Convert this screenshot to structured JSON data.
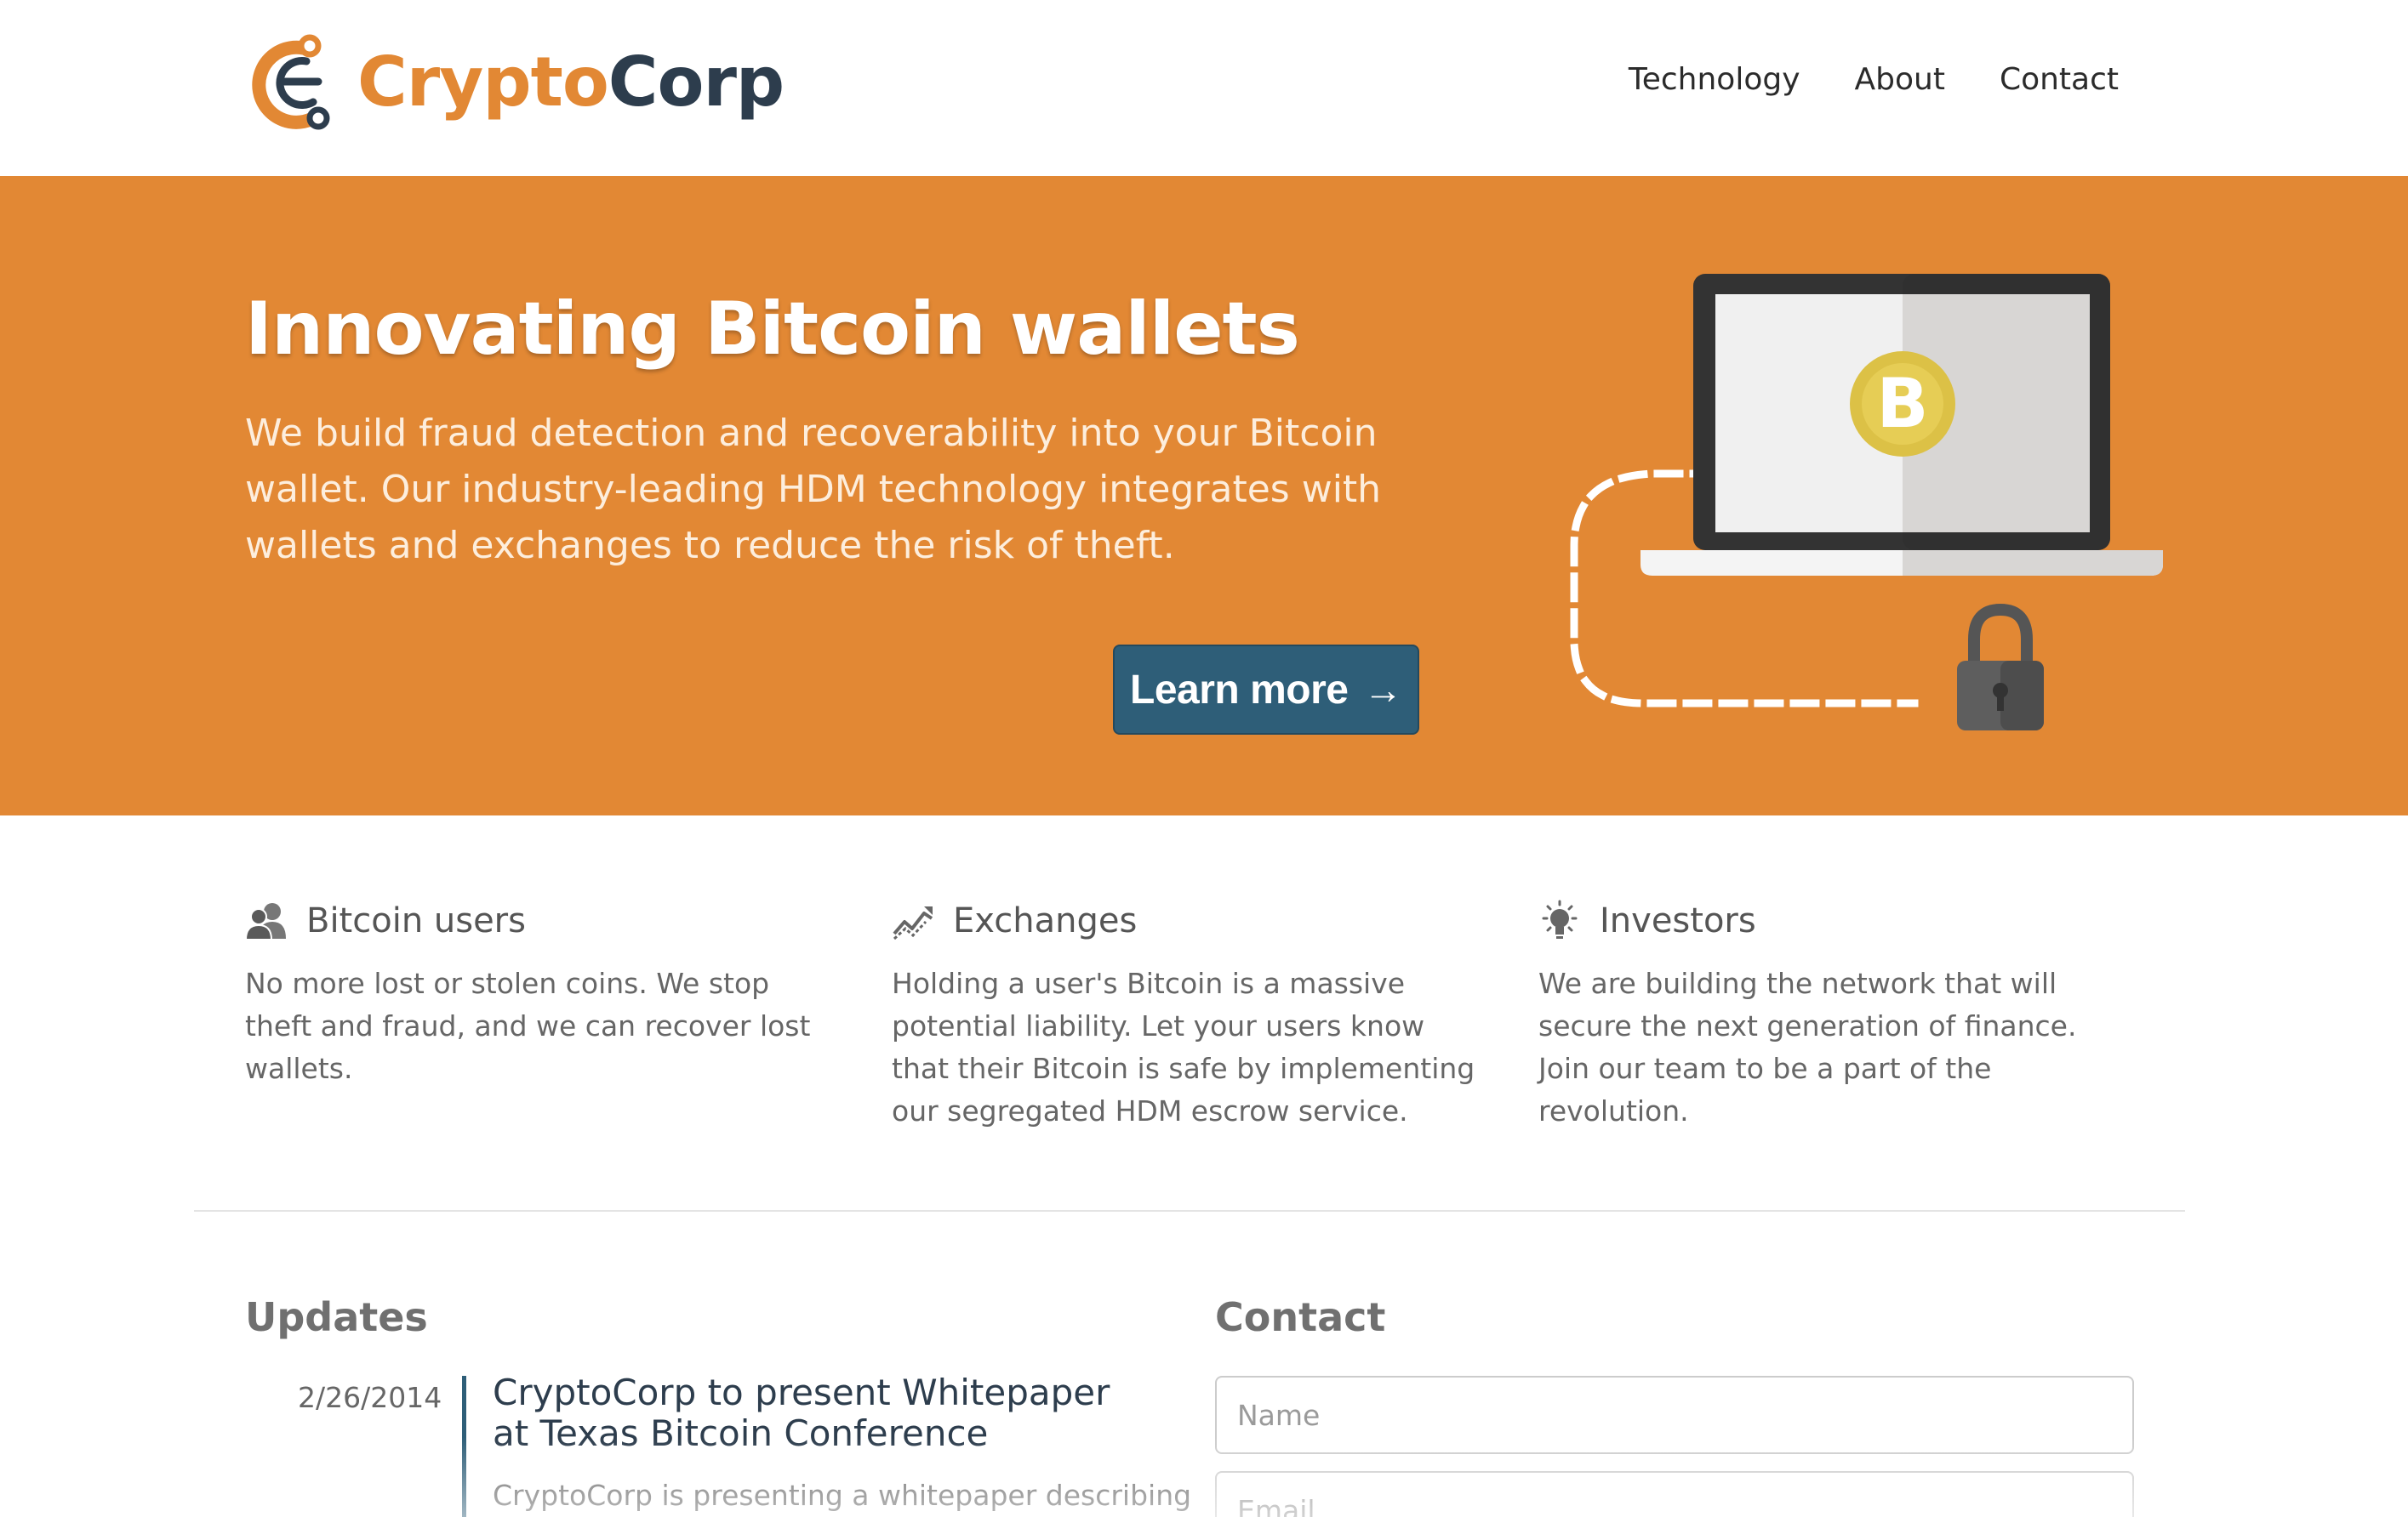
{
  "header": {
    "logo": {
      "part1": "Crypto",
      "part2": "Corp"
    },
    "nav": [
      "Technology",
      "About",
      "Contact"
    ]
  },
  "hero": {
    "title": "Innovating Bitcoin wallets",
    "description": "We build fraud detection and recoverability into your Bitcoin wallet. Our industry-leading HDM technology integrates with wallets and exchanges to reduce the risk of theft.",
    "button_label": "Learn more",
    "button_arrow": "→",
    "illustration_icon": "laptop-bitcoin-lock-icon"
  },
  "features": [
    {
      "icon": "users-icon",
      "title": "Bitcoin users",
      "text": "No more lost or stolen coins. We stop theft and fraud, and we can recover lost wallets."
    },
    {
      "icon": "trend-chart-icon",
      "title": "Exchanges",
      "text": "Holding a user's Bitcoin is a massive potential liability. Let your users know that their Bitcoin is safe by implementing our segregated HDM escrow service."
    },
    {
      "icon": "lightbulb-icon",
      "title": "Investors",
      "text": "We are building the network that will secure the next generation of finance. Join our team to be a part of the revolution."
    }
  ],
  "updates": {
    "heading": "Updates",
    "items": [
      {
        "date": "2/26/2014",
        "title": "CryptoCorp to present Whitepaper at Texas Bitcoin Conference",
        "text": "CryptoCorp is presenting a whitepaper describing"
      }
    ]
  },
  "contact": {
    "heading": "Contact",
    "name_placeholder": "Name",
    "email_placeholder": "Email"
  },
  "colors": {
    "brand_orange": "#e28834",
    "brand_navy": "#2d3d4d",
    "button_blue": "#2e5e78"
  }
}
